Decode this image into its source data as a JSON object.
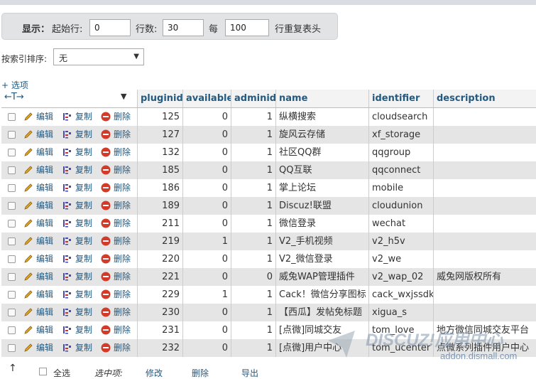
{
  "nav": {
    "show_label": "显示：",
    "start_label": "起始行:",
    "start_value": "0",
    "rows_label": "行数:",
    "rows_value": "30",
    "every_label": "每",
    "every_value": "100",
    "repeat_label": "行重复表头"
  },
  "sort": {
    "label": "按索引排序:",
    "value": "无"
  },
  "options_link": "+ 选项",
  "columns": [
    "pluginid",
    "available",
    "adminid",
    "name",
    "identifier",
    "description"
  ],
  "actions": {
    "edit": "编辑",
    "copy": "复制",
    "delete": "删除"
  },
  "rows": [
    {
      "pluginid": "125",
      "available": "0",
      "adminid": "1",
      "name": "纵横搜索",
      "identifier": "cloudsearch",
      "description": ""
    },
    {
      "pluginid": "127",
      "available": "0",
      "adminid": "1",
      "name": "旋风云存储",
      "identifier": "xf_storage",
      "description": ""
    },
    {
      "pluginid": "132",
      "available": "0",
      "adminid": "1",
      "name": "社区QQ群",
      "identifier": "qqgroup",
      "description": ""
    },
    {
      "pluginid": "185",
      "available": "0",
      "adminid": "1",
      "name": "QQ互联",
      "identifier": "qqconnect",
      "description": ""
    },
    {
      "pluginid": "186",
      "available": "0",
      "adminid": "1",
      "name": "掌上论坛",
      "identifier": "mobile",
      "description": ""
    },
    {
      "pluginid": "189",
      "available": "0",
      "adminid": "1",
      "name": "Discuz!联盟",
      "identifier": "cloudunion",
      "description": ""
    },
    {
      "pluginid": "211",
      "available": "0",
      "adminid": "1",
      "name": "微信登录",
      "identifier": "wechat",
      "description": ""
    },
    {
      "pluginid": "219",
      "available": "1",
      "adminid": "1",
      "name": "V2_手机视频",
      "identifier": "v2_h5v",
      "description": ""
    },
    {
      "pluginid": "220",
      "available": "0",
      "adminid": "1",
      "name": "V2_微信登录",
      "identifier": "v2_we",
      "description": ""
    },
    {
      "pluginid": "221",
      "available": "0",
      "adminid": "0",
      "name": "威兔WAP管理插件",
      "identifier": "v2_wap_02",
      "description": "威兔网版权所有"
    },
    {
      "pluginid": "229",
      "available": "1",
      "adminid": "1",
      "name": "Cack！微信分享图标",
      "identifier": "cack_wxjssdk",
      "description": ""
    },
    {
      "pluginid": "230",
      "available": "0",
      "adminid": "1",
      "name": "【西瓜】发帖免标题",
      "identifier": "xigua_s",
      "description": ""
    },
    {
      "pluginid": "231",
      "available": "0",
      "adminid": "1",
      "name": "[点微]同城交友",
      "identifier": "tom_love",
      "description": "地方微信同城交友平台"
    },
    {
      "pluginid": "232",
      "available": "0",
      "adminid": "1",
      "name": "[点微]用户中心",
      "identifier": "tom_ucenter",
      "description": "点微系列插件用户中心"
    }
  ],
  "bottom": {
    "check_all": "全选",
    "selected": "选中项:",
    "edit": "修改",
    "delete": "删除",
    "export": "导出"
  },
  "watermark": {
    "brand": "DISCUZ!应用中心",
    "url": "addon.dismall.com"
  },
  "colors": {
    "link": "#235a81",
    "row_alt": "#e5e5e5",
    "delete_icon": "#d23a2a",
    "edit_icon": "#e0a526"
  }
}
